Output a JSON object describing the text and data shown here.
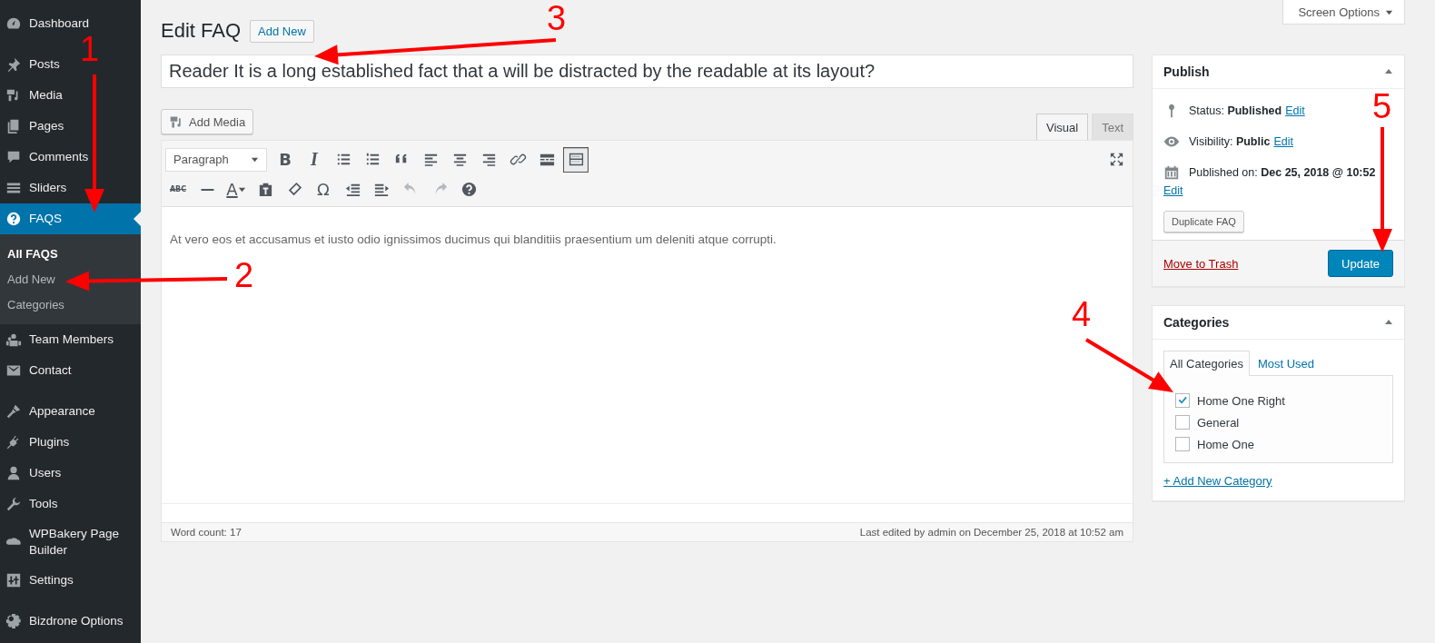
{
  "sidebar": {
    "items": [
      {
        "label": "Dashboard",
        "selected": false
      },
      {
        "label": "Posts",
        "selected": false
      },
      {
        "label": "Media",
        "selected": false
      },
      {
        "label": "Pages",
        "selected": false
      },
      {
        "label": "Comments",
        "selected": false
      },
      {
        "label": "Sliders",
        "selected": false
      },
      {
        "label": "FAQS",
        "selected": true,
        "children": [
          {
            "label": "All FAQS",
            "selected": true
          },
          {
            "label": "Add New",
            "selected": false
          },
          {
            "label": "Categories",
            "selected": false
          }
        ]
      },
      {
        "label": "Team Members",
        "selected": false
      },
      {
        "label": "Contact",
        "selected": false
      },
      {
        "label": "Appearance",
        "selected": false
      },
      {
        "label": "Plugins",
        "selected": false
      },
      {
        "label": "Users",
        "selected": false
      },
      {
        "label": "Tools",
        "selected": false
      },
      {
        "label": "WPBakery Page Builder",
        "selected": false
      },
      {
        "label": "Settings",
        "selected": false
      },
      {
        "label": "Bizdrone Options",
        "selected": false
      }
    ]
  },
  "screen_options": {
    "label": "Screen Options"
  },
  "header": {
    "title": "Edit FAQ",
    "add_new": "Add New"
  },
  "post_title": {
    "value": "Reader It is a long established fact that a will be distracted by the readable at its layout?"
  },
  "editor": {
    "add_media": "Add Media",
    "tabs": [
      {
        "label": "Visual",
        "selected": true
      },
      {
        "label": "Text",
        "selected": false
      }
    ],
    "format": "Paragraph",
    "toolbar_rows": [
      [
        {
          "glyph": "B",
          "on": false
        },
        {
          "glyph": "I",
          "on": false
        },
        {
          "on": false
        },
        {
          "on": false
        },
        {
          "on": false
        },
        {
          "on": false
        },
        {
          "on": false
        },
        {
          "on": false
        },
        {
          "on": false
        },
        {
          "on": false
        },
        {
          "on": true
        }
      ],
      [
        {
          "glyph": "ABC",
          "disabled": false
        },
        {
          "disabled": false
        },
        {
          "glyph": "A",
          "disabled": false
        },
        {
          "disabled": false
        },
        {
          "disabled": false
        },
        {
          "glyph": "Ω",
          "disabled": false
        },
        {
          "disabled": false
        },
        {
          "disabled": false
        },
        {
          "disabled": true
        },
        {
          "disabled": true
        },
        {
          "disabled": false
        }
      ]
    ],
    "content": "At vero eos et accusamus et iusto odio ignissimos ducimus qui blanditiis praesentium um deleniti atque corrupti.",
    "word_count": "Word count: 17",
    "last_edited": "Last edited by admin on December 25, 2018 at 10:52 am"
  },
  "publish": {
    "title": "Publish",
    "rows": [
      {
        "label": "Status:",
        "value": "Published",
        "link": "Edit"
      },
      {
        "label": "Visibility:",
        "value": "Public",
        "link": "Edit"
      },
      {
        "label": "Published on:",
        "value": "Dec 25, 2018 @ 10:52",
        "link": "Edit"
      }
    ],
    "duplicate": "Duplicate FAQ",
    "trash": "Move to Trash",
    "update": "Update"
  },
  "categories": {
    "title": "Categories",
    "tabs": [
      {
        "label": "All Categories",
        "selected": true
      },
      {
        "label": "Most Used",
        "selected": false
      }
    ],
    "items": [
      {
        "label": "Home One Right",
        "checked": true
      },
      {
        "label": "General",
        "checked": false
      },
      {
        "label": "Home One",
        "checked": false
      }
    ],
    "add_new": "+ Add New Category"
  },
  "annotations": [
    {
      "label": "1"
    },
    {
      "label": "2"
    },
    {
      "label": "3"
    },
    {
      "label": "4"
    },
    {
      "label": "5"
    }
  ]
}
